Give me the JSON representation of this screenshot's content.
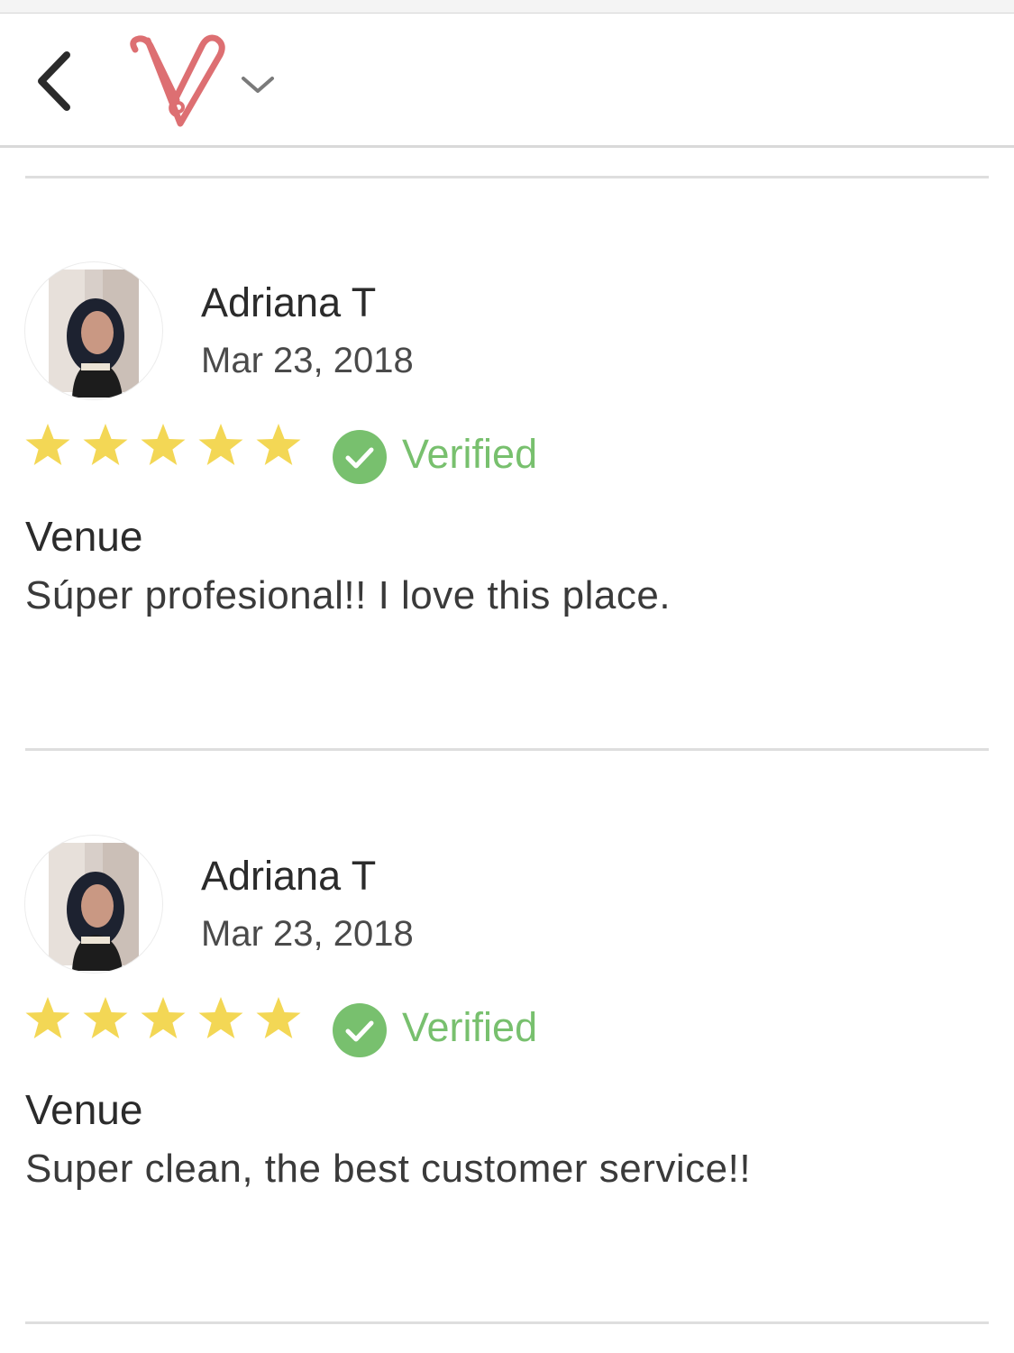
{
  "header": {
    "back_icon": "chevron-left-icon",
    "logo_icon": "app-logo-icon",
    "menu_icon": "chevron-down-icon"
  },
  "colors": {
    "star": "#f3d755",
    "verified": "#78c06e",
    "logo": "#dd6f72",
    "divider": "#dedede"
  },
  "reviews": [
    {
      "author": "Adriana T",
      "date": "Mar 23, 2018",
      "rating": 5,
      "verified_label": "Verified",
      "category": "Venue",
      "text": "Súper profesional!! I love this place."
    },
    {
      "author": "Adriana T",
      "date": "Mar 23, 2018",
      "rating": 5,
      "verified_label": "Verified",
      "category": "Venue",
      "text": "Super clean, the best customer service!!"
    }
  ]
}
